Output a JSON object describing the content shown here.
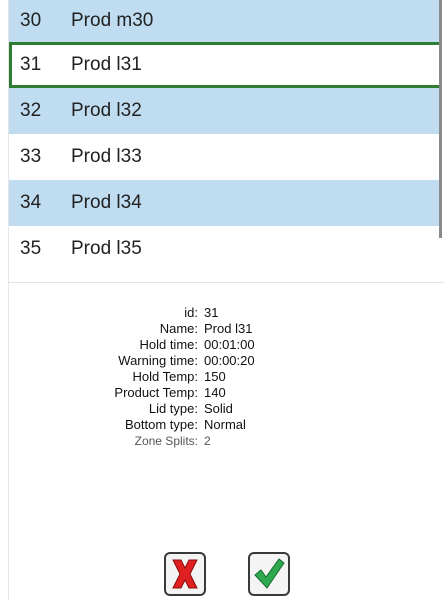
{
  "list": {
    "rows": [
      {
        "id": "30",
        "name": "Prod m30"
      },
      {
        "id": "31",
        "name": "Prod l31"
      },
      {
        "id": "32",
        "name": "Prod l32"
      },
      {
        "id": "33",
        "name": "Prod l33"
      },
      {
        "id": "34",
        "name": "Prod l34"
      },
      {
        "id": "35",
        "name": "Prod l35"
      }
    ],
    "selected_id": "31"
  },
  "details": {
    "id_label": "id:",
    "id_value": "31",
    "name_label": "Name:",
    "name_value": "Prod l31",
    "hold_time_label": "Hold time:",
    "hold_time_value": "00:01:00",
    "warning_time_label": "Warning time:",
    "warning_time_value": "00:00:20",
    "hold_temp_label": "Hold Temp:",
    "hold_temp_value": "150",
    "product_temp_label": "Product Temp:",
    "product_temp_value": "140",
    "lid_type_label": "Lid type:",
    "lid_type_value": "Solid",
    "bottom_type_label": "Bottom type:",
    "bottom_type_value": "Normal",
    "zone_splits_label": "Zone Splits:",
    "zone_splits_value": "2"
  },
  "buttons": {
    "cancel_icon": "red-x-icon",
    "ok_icon": "green-check-icon"
  },
  "colors": {
    "row_alt": "#bfdcf1",
    "selected_border": "#2e7d32",
    "cancel_red": "#e02020",
    "ok_green": "#2fa84f"
  }
}
